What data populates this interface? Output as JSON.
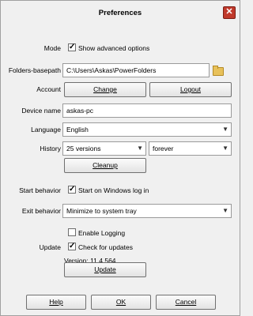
{
  "window": {
    "title": "Preferences"
  },
  "mode": {
    "label": "Mode",
    "checkbox_label": "Show advanced options",
    "checked": true
  },
  "folders_basepath": {
    "label": "Folders-basepath",
    "value": "C:\\Users\\Askas\\PowerFolders",
    "icon": "folder-icon"
  },
  "account": {
    "label": "Account",
    "change_label": "Change",
    "logout_label": "Logout"
  },
  "device_name": {
    "label": "Device name",
    "value": "askas-pc"
  },
  "language": {
    "label": "Language",
    "value": "English"
  },
  "history": {
    "label": "History",
    "versions_value": "25 versions",
    "duration_value": "forever",
    "cleanup_label": "Cleanup"
  },
  "start_behavior": {
    "label": "Start behavior",
    "checkbox_label": "Start on Windows log in",
    "checked": true
  },
  "exit_behavior": {
    "label": "Exit behavior",
    "value": "Minimize to system tray"
  },
  "logging": {
    "checkbox_label": "Enable Logging",
    "checked": false
  },
  "update": {
    "label": "Update",
    "checkbox_label": "Check for updates",
    "checked": true,
    "version_text": "Version: 11.4.564",
    "button_label": "Update"
  },
  "footer": {
    "help_label": "Help",
    "ok_label": "OK",
    "cancel_label": "Cancel"
  }
}
